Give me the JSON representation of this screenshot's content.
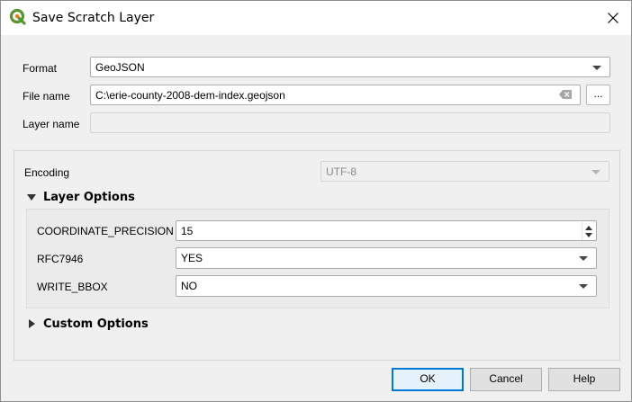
{
  "window": {
    "title": "Save Scratch Layer"
  },
  "form": {
    "format_label": "Format",
    "format_value": "GeoJSON",
    "filename_label": "File name",
    "filename_value": "C:\\erie-county-2008-dem-index.geojson",
    "browse_label": "...",
    "layername_label": "Layer name",
    "layername_value": ""
  },
  "encoding": {
    "label": "Encoding",
    "value": "UTF-8"
  },
  "layer_options": {
    "header": "Layer Options",
    "expanded": true,
    "coordinate_precision_label": "COORDINATE_PRECISION",
    "coordinate_precision_value": "15",
    "rfc7946_label": "RFC7946",
    "rfc7946_value": "YES",
    "write_bbox_label": "WRITE_BBOX",
    "write_bbox_value": "NO"
  },
  "custom_options": {
    "header": "Custom Options",
    "expanded": false
  },
  "buttons": {
    "ok": "OK",
    "cancel": "Cancel",
    "help": "Help"
  },
  "icons": {
    "app": "qgis-logo-icon",
    "close": "close-icon",
    "clear": "clear-text-icon"
  },
  "colors": {
    "accent": "#0078d7",
    "qgis_green": "#589632",
    "qgis_yellow": "#ee7913"
  }
}
